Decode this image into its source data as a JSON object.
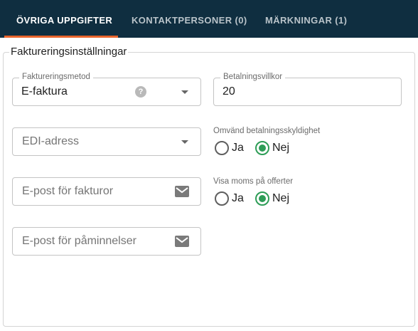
{
  "tabs": [
    {
      "label": "ÖVRIGA UPPGIFTER",
      "active": true
    },
    {
      "label": "KONTAKTPERSONER (0)",
      "active": false
    },
    {
      "label": "MÄRKNINGAR (1)",
      "active": false
    }
  ],
  "section": {
    "legend": "Faktureringsinställningar"
  },
  "fields": {
    "invoice_method": {
      "label": "Faktureringsmetod",
      "value": "E-faktura",
      "help_icon": "help-circle-icon",
      "help_glyph": "?"
    },
    "payment_terms": {
      "label": "Betalningsvillkor",
      "value": "20"
    },
    "edi_address": {
      "placeholder": "EDI-adress"
    },
    "invoice_email": {
      "placeholder": "E-post för fakturor",
      "icon": "email-icon"
    },
    "reminder_email": {
      "placeholder": "E-post för påminnelser",
      "icon": "email-icon"
    }
  },
  "reverse_vat": {
    "label": "Omvänd betalningsskyldighet",
    "options": [
      "Ja",
      "Nej"
    ],
    "selected": "Nej"
  },
  "show_vat": {
    "label": "Visa moms på offerter",
    "options": [
      "Ja",
      "Nej"
    ],
    "selected": "Nej"
  },
  "colors": {
    "tabbar": "#0f2e40",
    "tab_indicator": "#e8642c",
    "radio_checked": "#2e9d57"
  }
}
